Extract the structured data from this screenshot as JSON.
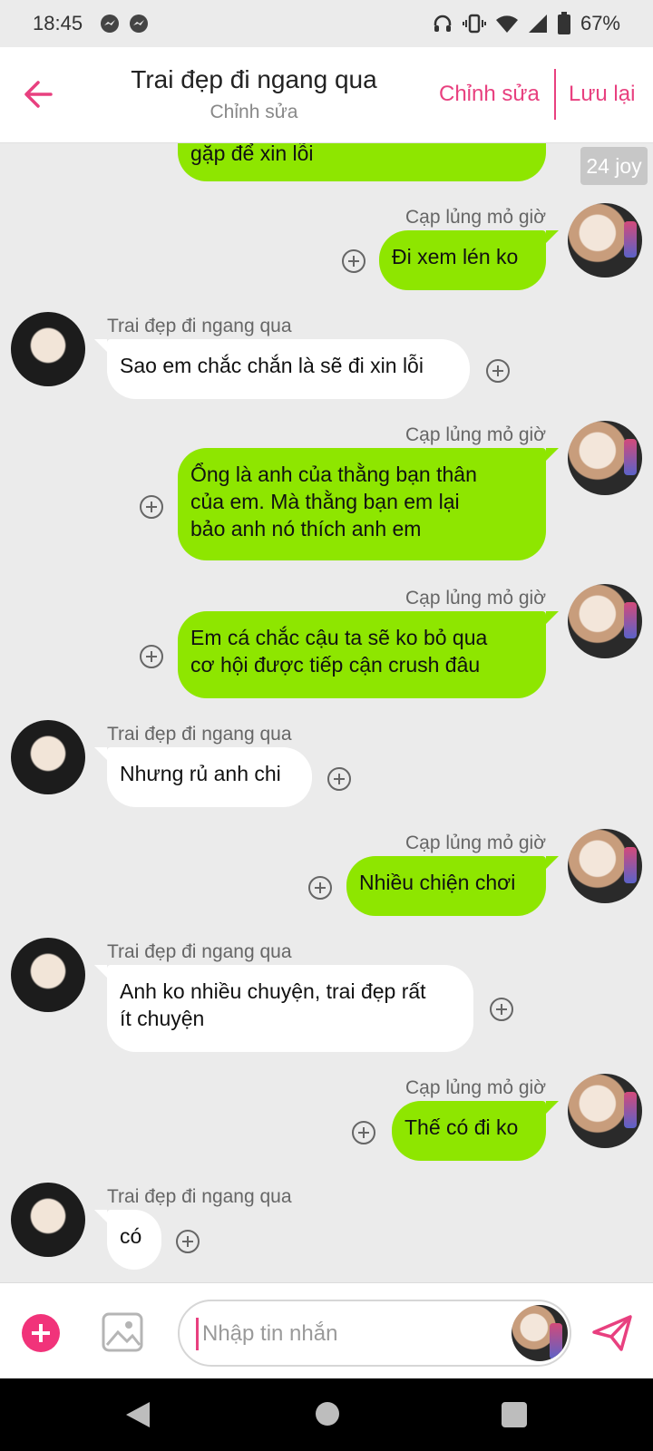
{
  "status_bar": {
    "time": "18:45",
    "battery": "67%"
  },
  "header": {
    "title": "Trai đẹp đi ngang qua",
    "subtitle": "Chỉnh sửa",
    "edit_label": "Chỉnh sửa",
    "save_label": "Lưu lại"
  },
  "chat": {
    "joy_badge": "24 joy",
    "partial_top_message": "gặp để xin lỗi",
    "messages": [
      {
        "side": "me",
        "sender": "Cạp lủng mỏ giờ",
        "text": "Đi xem lén ko"
      },
      {
        "side": "them",
        "sender": "Trai đẹp đi ngang qua",
        "text": "Sao em chắc chắn là sẽ đi xin lỗi"
      },
      {
        "side": "me",
        "sender": "Cạp lủng mỏ giờ",
        "lines": [
          "Ổng là anh của thằng bạn thân",
          "của em. Mà thằng bạn em lại",
          "bảo anh nó thích anh em"
        ]
      },
      {
        "side": "me",
        "sender": "Cạp lủng mỏ giờ",
        "lines": [
          "Em cá chắc cậu ta sẽ ko bỏ qua",
          "cơ hội được tiếp cận crush đâu"
        ]
      },
      {
        "side": "them",
        "sender": "Trai đẹp đi ngang qua",
        "text": "Nhưng rủ anh chi"
      },
      {
        "side": "me",
        "sender": "Cạp lủng mỏ giờ",
        "text": "Nhiều chiện chơi"
      },
      {
        "side": "them",
        "sender": "Trai đẹp đi ngang qua",
        "lines": [
          "Anh ko nhiều chuyện, trai đẹp rất",
          "ít chuyện"
        ]
      },
      {
        "side": "me",
        "sender": "Cạp lủng mỏ giờ",
        "text": "Thế có đi ko"
      },
      {
        "side": "them",
        "sender": "Trai đẹp đi ngang qua",
        "text": "có"
      }
    ]
  },
  "composer": {
    "placeholder": "Nhập tin nhắn"
  },
  "colors": {
    "accent": "#e8407f",
    "my_bubble": "#8ee600",
    "their_bubble": "#ffffff"
  },
  "icons": [
    "messenger-icon",
    "headphones-icon",
    "vibrate-icon",
    "wifi-icon",
    "signal-icon",
    "battery-icon",
    "back-arrow-icon",
    "add-icon",
    "image-icon",
    "send-icon"
  ]
}
